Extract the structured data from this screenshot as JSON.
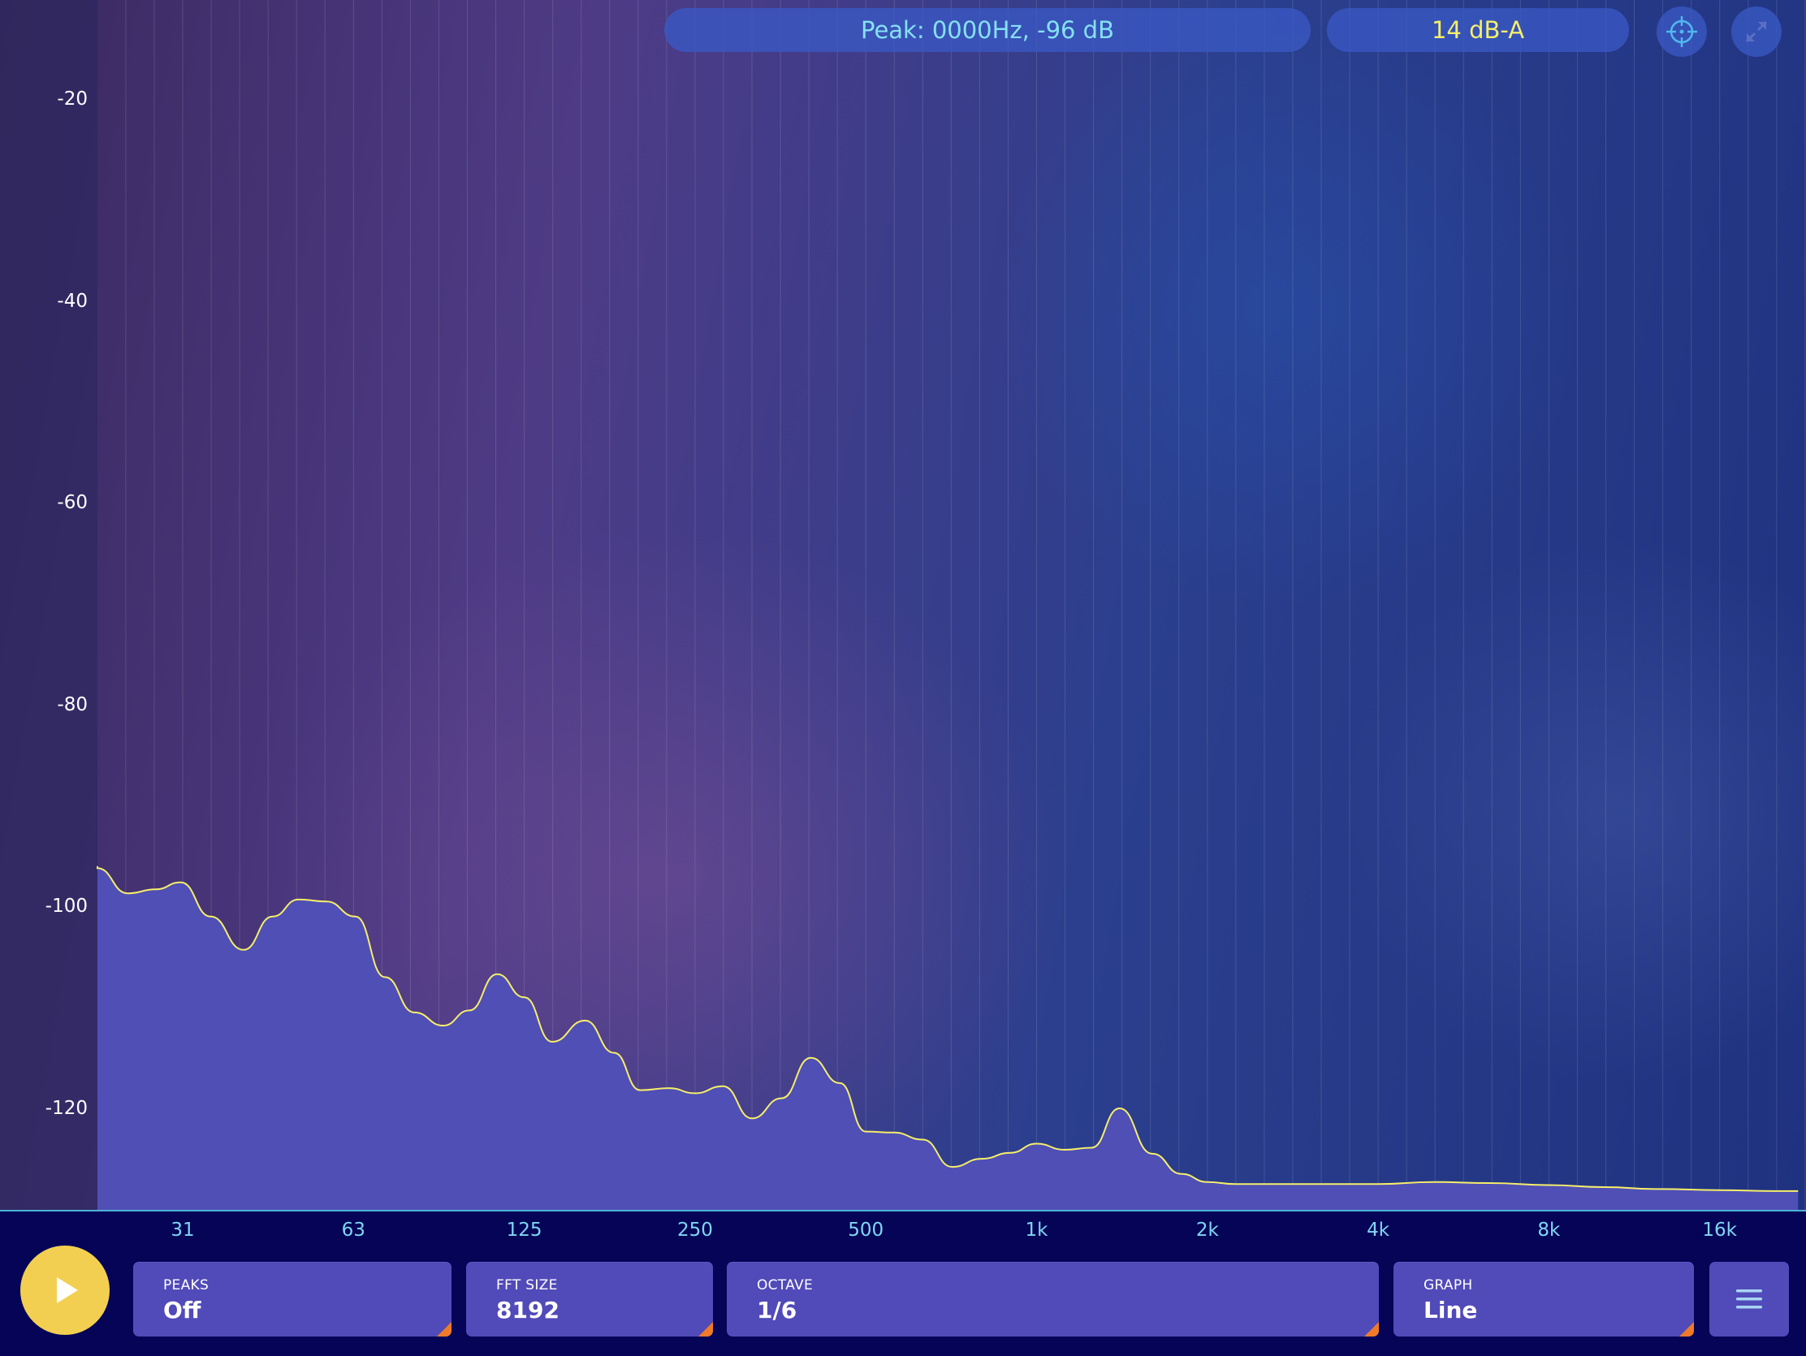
{
  "header": {
    "peak_readout": "Peak: 0000Hz, -96 dB",
    "level_readout": "14 dB-A",
    "crosshair_icon": "crosshair-icon",
    "expand_icon": "expand-icon"
  },
  "controls": {
    "play_icon": "play-icon",
    "peaks": {
      "title": "PEAKS",
      "value": "Off"
    },
    "fft_size": {
      "title": "FFT SIZE",
      "value": "8192"
    },
    "octave": {
      "title": "OCTAVE",
      "value": "1/6"
    },
    "graph": {
      "title": "GRAPH",
      "value": "Line"
    },
    "menu_icon": "hamburger-menu-icon"
  },
  "colors": {
    "spectrum_line": "#f6ee6a",
    "spectrum_fill": "#4f4fb6",
    "accent_yellow": "#f2cf50",
    "readout_cyan": "#84e1f2",
    "readout_yellow": "#f5ee6a",
    "axis_label_cyan": "#7fd6f2",
    "corner_orange": "#ef7a2b"
  },
  "chart_data": {
    "type": "area",
    "x_scale": "log",
    "y_unit": "dB",
    "y_ticks": [
      "-20",
      "-40",
      "-60",
      "-80",
      "-100",
      "-120"
    ],
    "x_ticks": [
      "31",
      "63",
      "125",
      "250",
      "500",
      "1k",
      "2k",
      "4k",
      "8k",
      "16k"
    ],
    "xlim": [
      20,
      22000
    ],
    "ylim": [
      -130,
      -10
    ],
    "series": [
      {
        "x": [
          20,
          22,
          25,
          28,
          31,
          35,
          40,
          45,
          50,
          56,
          63,
          71,
          80,
          90,
          100,
          112,
          125,
          140,
          160,
          180,
          200,
          225,
          250,
          280,
          315,
          355,
          400,
          450,
          500,
          560,
          630,
          710,
          800,
          900,
          1000,
          1120,
          1250,
          1400,
          1600,
          1800,
          2000,
          2240,
          2500,
          3150,
          4000,
          5000,
          6300,
          8000,
          10000,
          12500,
          16000,
          20000,
          22000
        ],
        "y": [
          -96,
          -96.2,
          -98.7,
          -98.3,
          -97.6,
          -101,
          -104.3,
          -101,
          -99.3,
          -99.5,
          -101,
          -107,
          -110.5,
          -111.8,
          -110.3,
          -106.7,
          -109,
          -113.4,
          -111.3,
          -114.5,
          -118.2,
          -118,
          -118.5,
          -117.8,
          -121,
          -119,
          -115,
          -117.5,
          -122.3,
          -122.4,
          -123.1,
          -125.8,
          -125,
          -124.4,
          -123.5,
          -124.1,
          -123.9,
          -120,
          -124.5,
          -126.5,
          -127.3,
          -127.5,
          -127.5,
          -127.5,
          -127.5,
          -127.3,
          -127.4,
          -127.6,
          -127.8,
          -128.0,
          -128.1,
          -128.2,
          -128.2
        ]
      }
    ],
    "grid": true
  }
}
